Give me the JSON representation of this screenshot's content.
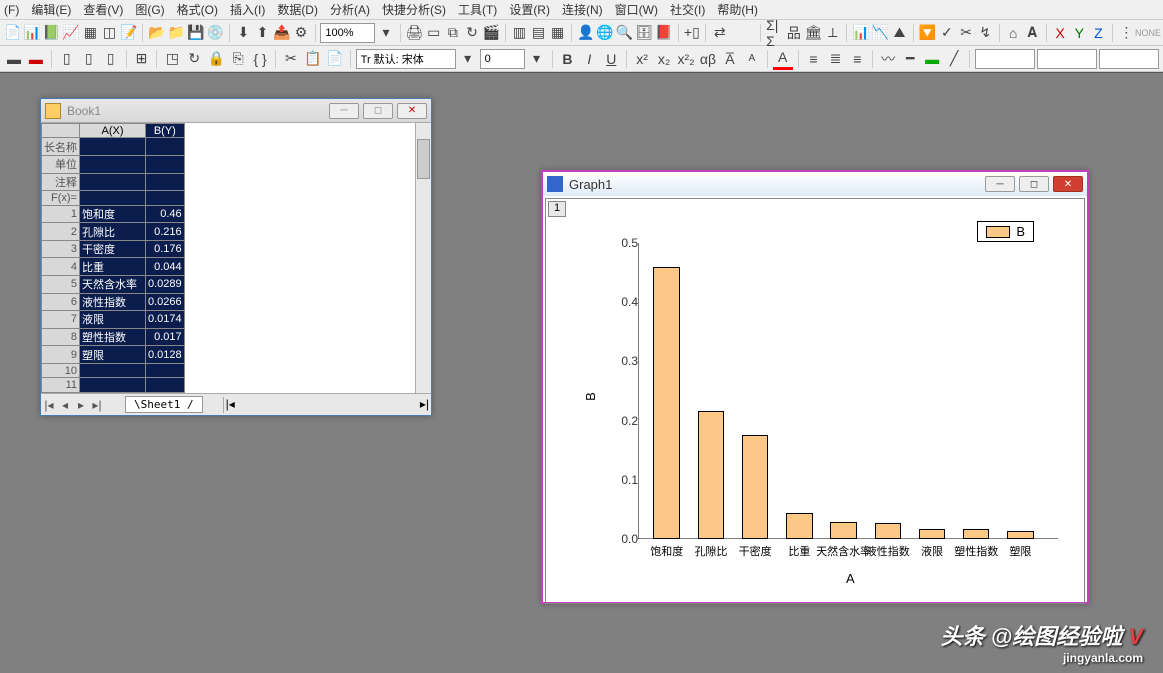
{
  "menu": [
    "(F)",
    "编辑(E)",
    "查看(V)",
    "图(G)",
    "格式(O)",
    "插入(I)",
    "数据(D)",
    "分析(A)",
    "快捷分析(S)",
    "工具(T)",
    "设置(R)",
    "连接(N)",
    "窗口(W)",
    "社交(I)",
    "帮助(H)"
  ],
  "toolbar1": {
    "zoom": "100%",
    "font_label": "Tr 默认: 宋体",
    "font_size": "0"
  },
  "book": {
    "title": "Book1",
    "col_headers": [
      "A(X)",
      "B(Y)"
    ],
    "row_headers": [
      "长名称",
      "单位",
      "注释",
      "F(x)=",
      "1",
      "2",
      "3",
      "4",
      "5",
      "6",
      "7",
      "8",
      "9",
      "10",
      "11"
    ],
    "labels": [
      "",
      "",
      "",
      "",
      "饱和度",
      "孔隙比",
      "干密度",
      "比重",
      "天然含水率",
      "液性指数",
      "液限",
      "塑性指数",
      "塑限",
      "",
      ""
    ],
    "values": [
      "",
      "",
      "",
      "",
      "0.46",
      "0.216",
      "0.176",
      "0.044",
      "0.0289",
      "0.0266",
      "0.0174",
      "0.017",
      "0.0128",
      "",
      ""
    ],
    "sheet_tab": "Sheet1"
  },
  "graph": {
    "title": "Graph1",
    "layer": "1",
    "legend": "B",
    "ylabel": "B",
    "xlabel": "A"
  },
  "chart_data": {
    "type": "bar",
    "categories": [
      "饱和度",
      "孔隙比",
      "干密度",
      "比重",
      "天然含水率",
      "液性指数",
      "液限",
      "塑性指数",
      "塑限"
    ],
    "values": [
      0.46,
      0.216,
      0.176,
      0.044,
      0.0289,
      0.0266,
      0.0174,
      0.017,
      0.0128
    ],
    "ylim": [
      0.0,
      0.5
    ],
    "yticks": [
      0.0,
      0.1,
      0.2,
      0.3,
      0.4,
      0.5
    ],
    "xlabel": "A",
    "ylabel": "B",
    "legend": "B"
  },
  "watermark": {
    "main": "头条 @绘图经验啦 ",
    "red": "V",
    "sub": "jingyanla.com"
  }
}
